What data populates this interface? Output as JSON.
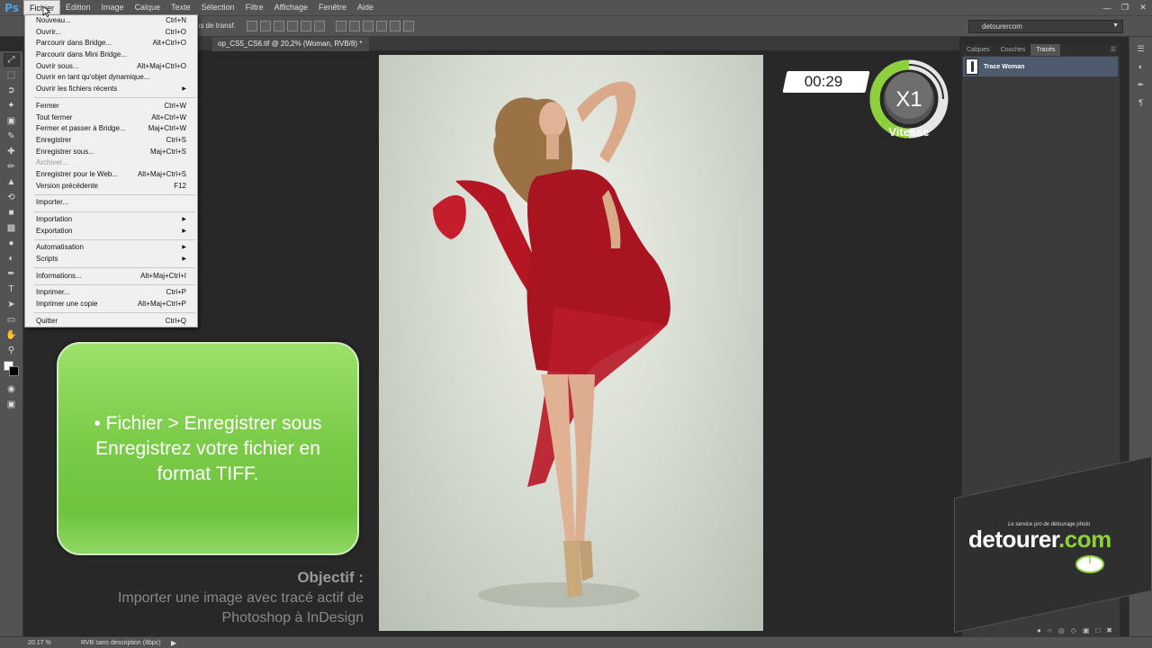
{
  "menubar": {
    "logo": "Ps",
    "items": [
      "Fichier",
      "Edition",
      "Image",
      "Calque",
      "Texte",
      "Sélection",
      "Filtre",
      "Affichage",
      "Fenêtre",
      "Aide"
    ],
    "active": "Fichier"
  },
  "options_bar": {
    "transform_text": "ns de transf.",
    "workspace": "detourercom"
  },
  "document_tab": {
    "title": "op_CS5_CS6.tif @ 20,2% (Woman, RVB/8) *"
  },
  "file_menu": {
    "groups": [
      [
        {
          "label": "Nouveau...",
          "shortcut": "Ctrl+N"
        },
        {
          "label": "Ouvrir...",
          "shortcut": "Ctrl+O"
        },
        {
          "label": "Parcourir dans Bridge...",
          "shortcut": "Alt+Ctrl+O"
        },
        {
          "label": "Parcourir dans Mini Bridge...",
          "shortcut": ""
        },
        {
          "label": "Ouvrir sous...",
          "shortcut": "Alt+Maj+Ctrl+O"
        },
        {
          "label": "Ouvrir en tant qu'objet dynamique...",
          "shortcut": ""
        },
        {
          "label": "Ouvrir les fichiers récents",
          "shortcut": "",
          "submenu": true
        }
      ],
      [
        {
          "label": "Fermer",
          "shortcut": "Ctrl+W"
        },
        {
          "label": "Tout fermer",
          "shortcut": "Alt+Ctrl+W"
        },
        {
          "label": "Fermer et passer à Bridge...",
          "shortcut": "Maj+Ctrl+W"
        },
        {
          "label": "Enregistrer",
          "shortcut": "Ctrl+S"
        },
        {
          "label": "Enregistrer sous...",
          "shortcut": "Maj+Ctrl+S"
        },
        {
          "label": "Archiver...",
          "shortcut": "",
          "disabled": true
        },
        {
          "label": "Enregistrer pour le Web...",
          "shortcut": "Alt+Maj+Ctrl+S"
        },
        {
          "label": "Version précédente",
          "shortcut": "F12"
        }
      ],
      [
        {
          "label": "Importer...",
          "shortcut": ""
        }
      ],
      [
        {
          "label": "Importation",
          "shortcut": "",
          "submenu": true
        },
        {
          "label": "Exportation",
          "shortcut": "",
          "submenu": true
        }
      ],
      [
        {
          "label": "Automatisation",
          "shortcut": "",
          "submenu": true
        },
        {
          "label": "Scripts",
          "shortcut": "",
          "submenu": true
        }
      ],
      [
        {
          "label": "Informations...",
          "shortcut": "Alt+Maj+Ctrl+I"
        }
      ],
      [
        {
          "label": "Imprimer...",
          "shortcut": "Ctrl+P"
        },
        {
          "label": "Imprimer une copie",
          "shortcut": "Alt+Maj+Ctrl+P"
        }
      ],
      [
        {
          "label": "Quitter",
          "shortcut": "Ctrl+Q"
        }
      ]
    ]
  },
  "overlay": {
    "timer": "00:29",
    "speed_value": "X1",
    "speed_label": "Vitesse",
    "instruction_lines": [
      "• Fichier > Enregistrer sous",
      "Enregistrez votre fichier en",
      "format TIFF."
    ],
    "objective_title": "Objectif :",
    "objective_lines": [
      "Importer une image avec tracé actif de",
      "Photoshop à InDesign"
    ]
  },
  "panel": {
    "tabs": [
      "Calques",
      "Couches",
      "Tracés"
    ],
    "active_tab": "Tracés",
    "path_name": "Trace Woman"
  },
  "logo": {
    "tagline": "Le service pro de détourage photo",
    "name_main": "detourer",
    "name_suffix": ".com"
  },
  "statusbar": {
    "zoom": "20.17 %",
    "doc_info": "RVB sans description (8bpc)"
  },
  "colors": {
    "accent_green": "#7ccc4a",
    "path_highlight": "#4e5a6e",
    "dress_red": "#a8141f"
  }
}
